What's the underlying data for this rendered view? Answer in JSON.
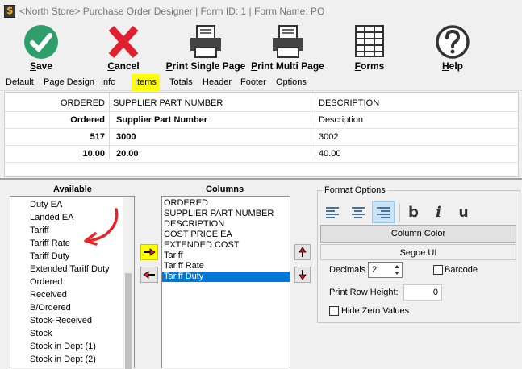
{
  "window": {
    "title": "<North Store> Purchase Order Designer | Form ID: 1 | Form Name: PO"
  },
  "toolbar": {
    "save": "Save",
    "cancel": "Cancel",
    "print_single": "Print Single Page",
    "print_multi": "Print Multi Page",
    "forms": "Forms",
    "help": "Help"
  },
  "tabs": [
    "Default",
    "Page Design",
    "Info",
    "Items",
    "Totals",
    "Header",
    "Footer",
    "Options"
  ],
  "active_tab": "Items",
  "grid": {
    "headers": [
      "ORDERED",
      "SUPPLIER PART NUMBER",
      "DESCRIPTION"
    ],
    "rows": [
      [
        "Ordered",
        "Supplier Part Number",
        "Description"
      ],
      [
        "517",
        "3000",
        "3002"
      ],
      [
        "10.00",
        "20.00",
        "40.00"
      ]
    ]
  },
  "available": {
    "heading": "Available",
    "items": [
      "Duty EA",
      "Landed EA",
      "Tariff",
      "Tariff Rate",
      "Tariff Duty",
      "Extended Tariff Duty",
      "Ordered",
      "Received",
      "B/Ordered",
      "Stock-Received",
      "Stock",
      "Stock in Dept (1)",
      "Stock in Dept (2)"
    ]
  },
  "columns": {
    "heading": "Columns",
    "items": [
      "ORDERED",
      "SUPPLIER PART NUMBER",
      "DESCRIPTION",
      "COST PRICE EA",
      "EXTENDED COST",
      "Tariff",
      "Tariff Rate",
      "Tariff Duty"
    ],
    "selected": "Tariff Duty"
  },
  "format": {
    "legend": "Format Options",
    "column_color": "Column Color",
    "font": "Segoe UI",
    "decimals_label": "Decimals",
    "decimals_value": "2",
    "barcode_label": "Barcode",
    "row_height_label": "Print Row Height:",
    "row_height_value": "0",
    "hide_zero_label": "Hide Zero Values"
  },
  "colors": {
    "highlight": "#ffff00",
    "selection": "#0078d7",
    "save_green": "#2e9e6b",
    "cancel_red": "#e0202f",
    "annotation_red": "#e8232a"
  }
}
